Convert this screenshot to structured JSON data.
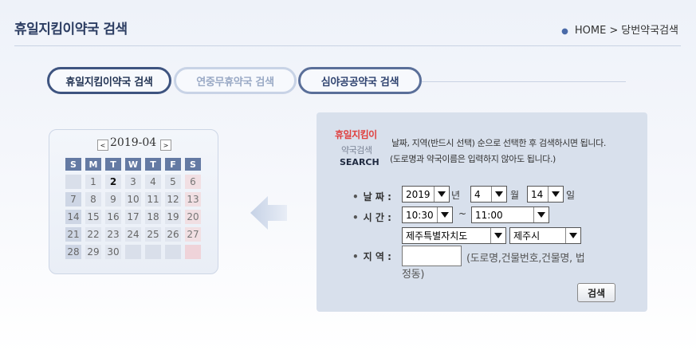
{
  "header": {
    "title": "휴일지킴이약국 검색",
    "breadcrumb": {
      "home": "HOME",
      "separator": ">",
      "current": "당번약국검색"
    }
  },
  "tabs": [
    {
      "label": "휴일지킴이약국 검색",
      "active": true
    },
    {
      "label": "연중무휴약국 검색",
      "active": false
    },
    {
      "label": "심야공공약국 검색",
      "active": false
    }
  ],
  "calendar": {
    "prev_label": "<",
    "next_label": ">",
    "month": "2019-04",
    "weekdays": [
      "S",
      "M",
      "T",
      "W",
      "T",
      "F",
      "S"
    ],
    "weeks": [
      [
        "",
        "1",
        "2",
        "3",
        "4",
        "5",
        "6"
      ],
      [
        "7",
        "8",
        "9",
        "10",
        "11",
        "12",
        "13"
      ],
      [
        "14",
        "15",
        "16",
        "17",
        "18",
        "19",
        "20"
      ],
      [
        "21",
        "22",
        "23",
        "24",
        "25",
        "26",
        "27"
      ],
      [
        "28",
        "29",
        "30",
        "",
        "",
        "",
        ""
      ]
    ],
    "current_day": "2"
  },
  "search": {
    "logo_top": "휴일지킴이",
    "logo_mid": "약국검색",
    "logo_bottom": "SEARCH",
    "instruction1": "날짜, 지역(반드시 선택) 순으로 선택한 후 검색하시면 됩니다.",
    "instruction2": "(도로명과 약국이름은 입력하지 않아도 됩니다.)",
    "date_label": "날 짜 :",
    "year_value": "2019",
    "year_unit": "년",
    "month_value": "4",
    "month_unit": "월",
    "day_value": "14",
    "day_unit": "일",
    "time_label": "시 간 :",
    "time_from": "10:30",
    "time_sep": "~",
    "time_to": "11:00",
    "province": "제주특별자치도",
    "city": "제주시",
    "region_label": "지 역 :",
    "region_value": "",
    "region_hint_line1": "(도로명,건물번호,건물명, 법",
    "region_hint_line2": "정동)",
    "button_label": "검색",
    "bullet": "•"
  },
  "colors": {
    "accent": "#3e5480",
    "panel": "#d8e0ec",
    "logo_red": "#e0403f"
  }
}
